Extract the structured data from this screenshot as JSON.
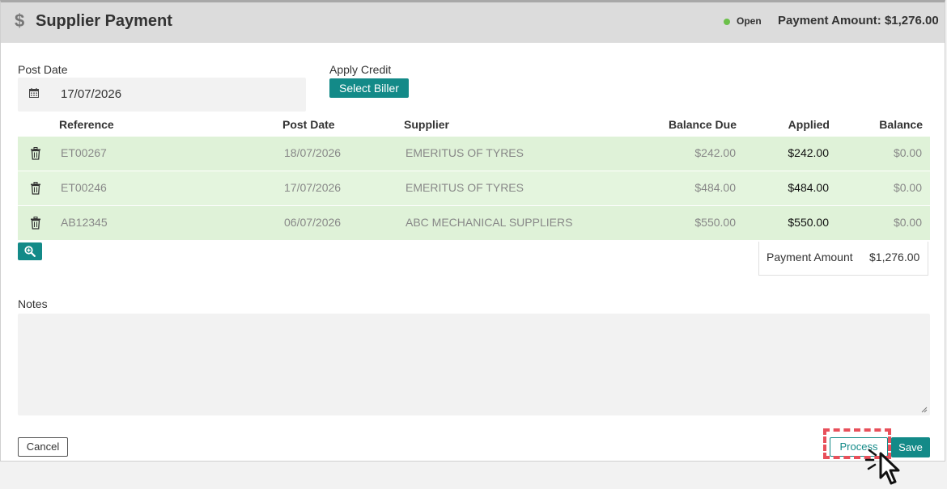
{
  "header": {
    "title": "Supplier Payment",
    "status": "Open",
    "payment_amount_label": "Payment Amount: $1,276.00",
    "status_color": "#6cc04a"
  },
  "form": {
    "post_date_label": "Post Date",
    "post_date_value": "17/07/2026",
    "apply_credit_label": "Apply Credit",
    "select_biller_label": "Select Biller"
  },
  "table": {
    "columns": [
      "Reference",
      "Post Date",
      "Supplier",
      "Balance Due",
      "Applied",
      "Balance"
    ],
    "rows": [
      {
        "reference": "ET00267",
        "post_date": "18/07/2026",
        "supplier": "EMERITUS OF TYRES",
        "balance_due": "$242.00",
        "applied": "$242.00",
        "balance": "$0.00"
      },
      {
        "reference": "ET00246",
        "post_date": "17/07/2026",
        "supplier": "EMERITUS OF TYRES",
        "balance_due": "$484.00",
        "applied": "$484.00",
        "balance": "$0.00"
      },
      {
        "reference": "AB12345",
        "post_date": "06/07/2026",
        "supplier": "ABC MECHANICAL SUPPLIERS",
        "balance_due": "$550.00",
        "applied": "$550.00",
        "balance": "$0.00"
      }
    ],
    "total_label": "Payment Amount",
    "total_value": "$1,276.00"
  },
  "notes": {
    "label": "Notes",
    "value": ""
  },
  "footer": {
    "cancel_label": "Cancel",
    "process_label": "Process",
    "save_label": "Save"
  },
  "colors": {
    "accent": "#138a88",
    "row_bg": "#dff2d8",
    "highlight": "#e8505b"
  }
}
